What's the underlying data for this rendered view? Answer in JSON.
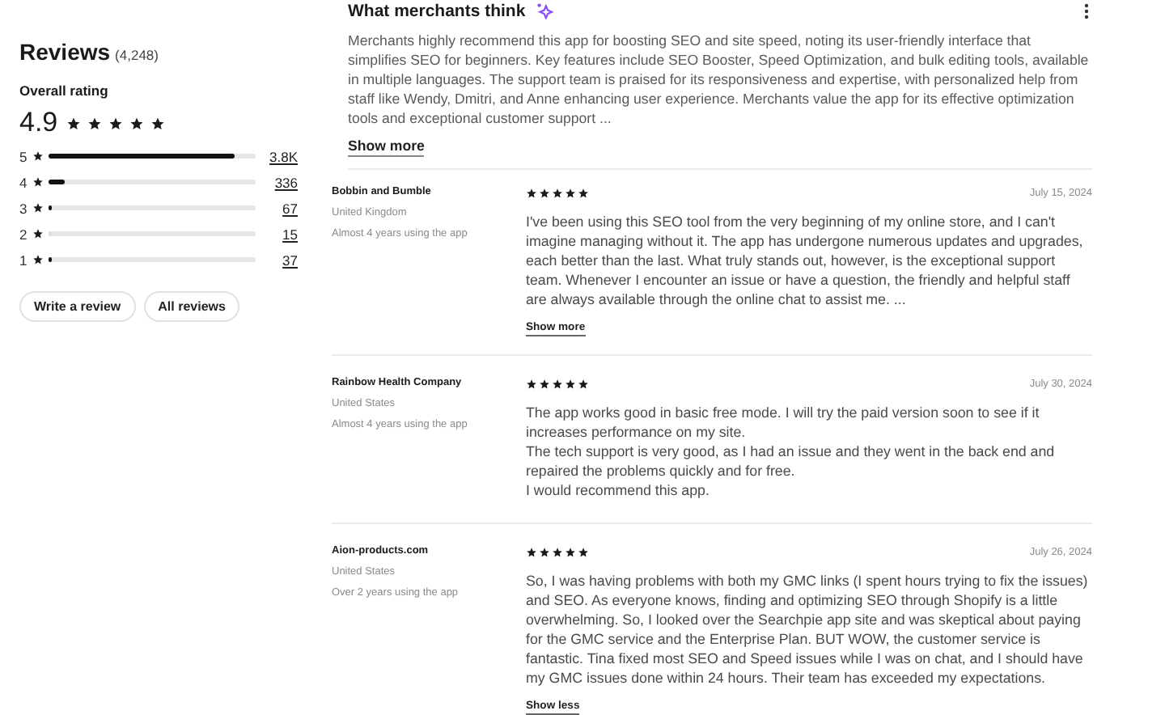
{
  "overview": {
    "title": "Reviews",
    "count": "(4,248)",
    "rating_label": "Overall rating",
    "rating": "4.9",
    "stars": 5,
    "histogram": [
      {
        "label": "5",
        "level": 0.9,
        "count": "3.8K"
      },
      {
        "label": "4",
        "level": 0.08,
        "count": "336"
      },
      {
        "label": "3",
        "level": 0.016,
        "count": "67"
      },
      {
        "label": "2",
        "level": 0,
        "count": "15"
      },
      {
        "label": "1",
        "level": 0.009,
        "count": "37"
      }
    ],
    "buttons": [
      "Write a review",
      "All reviews"
    ]
  },
  "summary": {
    "title": "What merchants think",
    "text": "Merchants highly recommend this app for boosting SEO and site speed, noting its user-friendly interface that simplifies SEO for beginners. Key features include SEO Booster, Speed Optimization, and bulk editing tools, available in multiple languages. The support team is praised for its responsiveness and expertise, with personalized help from staff like Wendy, Dmitri, and Anne enhancing user experience. Merchants value the app for its effective optimization tools and exceptional customer support ...",
    "toggle": "Show more"
  },
  "reviews": [
    {
      "author": "Bobbin and Bumble",
      "country": "United Kingdom",
      "tenure": "Almost 4 years using the app",
      "stars": 5,
      "date": "July 15, 2024",
      "paragraphs": [
        "I've been using this SEO tool from the very beginning of my online store, and I can't imagine managing without it. The app has undergone numerous updates and upgrades, each better than the last. What truly stands out, however, is the exceptional support team. Whenever I encounter an issue or have a question, the friendly and helpful staff are always available through the online chat to assist me. ..."
      ],
      "toggle": "Show more"
    },
    {
      "author": "Rainbow Health Company",
      "country": "United States",
      "tenure": "Almost 4 years using the app",
      "stars": 5,
      "date": "July 30, 2024",
      "paragraphs": [
        "The app works good in basic free mode. I will try the paid version soon to see if it increases performance on my site.",
        "The tech support is very good, as I had an issue and they went in the back end and repaired the problems quickly and for free.",
        "I would recommend this app."
      ]
    },
    {
      "author": "Aion-products.com",
      "country": "United States",
      "tenure": "Over 2 years using the app",
      "stars": 5,
      "date": "July 26, 2024",
      "paragraphs": [
        "So, I was having problems with both my GMC links (I spent hours trying to fix the issues) and SEO. As everyone knows, finding and optimizing SEO through Shopify is a little overwhelming. So, I looked over the Searchpie app site and was skeptical about paying for the GMC service and the Enterprise Plan. BUT WOW, the customer service is fantastic. Tina fixed most SEO and Speed issues while I was on chat, and I should have my GMC issues done within 24 hours. Their team has exceeded my expectations."
      ],
      "toggle": "Show less"
    }
  ]
}
